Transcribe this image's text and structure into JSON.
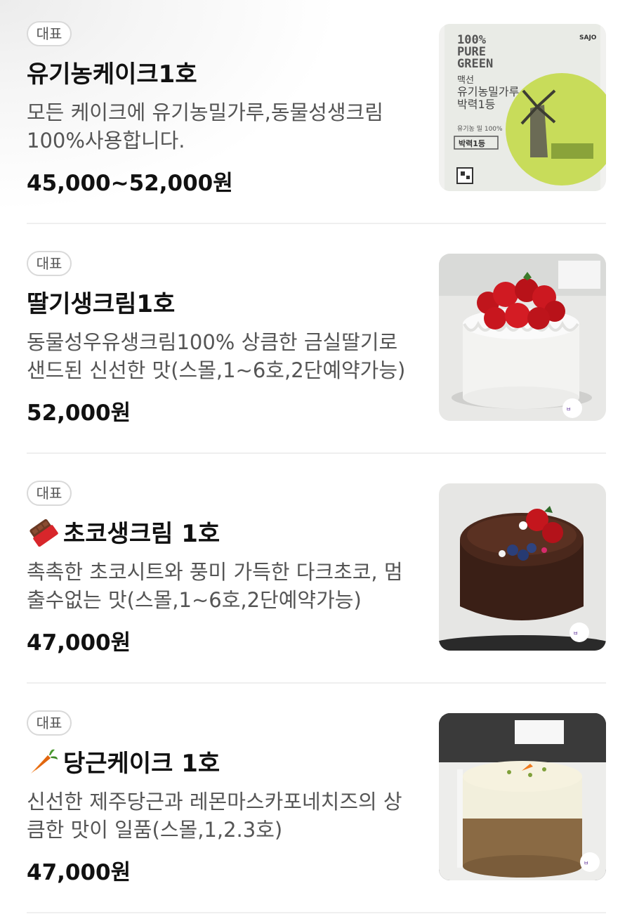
{
  "menu": {
    "items": [
      {
        "badge": "대표",
        "name": "유기농케이크1호",
        "description": "모든 케이크에 유기농밀가루,동물성생크림100%사용합니다.",
        "price": "45,000~52,000원",
        "image_icon": "flour-bag-image",
        "image_text": {
          "brand": "SAJO",
          "headline1": "100%",
          "headline2": "PURE",
          "headline3": "GREEN",
          "line1": "맥선",
          "line2": "유기농밀가루",
          "line3": "박력1등",
          "small": "유기농 밀 100%",
          "badge": "박력1등"
        }
      },
      {
        "badge": "대표",
        "name": "딸기생크림1호",
        "description": "동물성우유생크림100% 상큼한 금실딸기로 샌드된 신선한 맛(스몰,1~6호,2단예약가능)",
        "price": "52,000원",
        "image_icon": "strawberry-cake-image"
      },
      {
        "badge": "대표",
        "name": "초코생크림 1호",
        "name_icon": "chocolate-bar-icon",
        "description": "촉촉한 초코시트와 풍미 가득한 다크초코, 멈출수없는 맛(스몰,1~6호,2단예약가능)",
        "price": "47,000원",
        "image_icon": "chocolate-cake-image"
      },
      {
        "badge": "대표",
        "name": "당근케이크 1호",
        "name_icon": "carrot-icon",
        "description": "신선한 제주당근과 레몬마스카포네치즈의 상큼한 맛이 일품(스몰,1,2.3호)",
        "price": "47,000원",
        "image_icon": "carrot-cake-image"
      }
    ]
  },
  "colors": {
    "text_primary": "#111111",
    "text_secondary": "#555555",
    "badge_border": "#d9d9d9",
    "divider": "#efefef",
    "flour_green": "#c8dc5a"
  }
}
